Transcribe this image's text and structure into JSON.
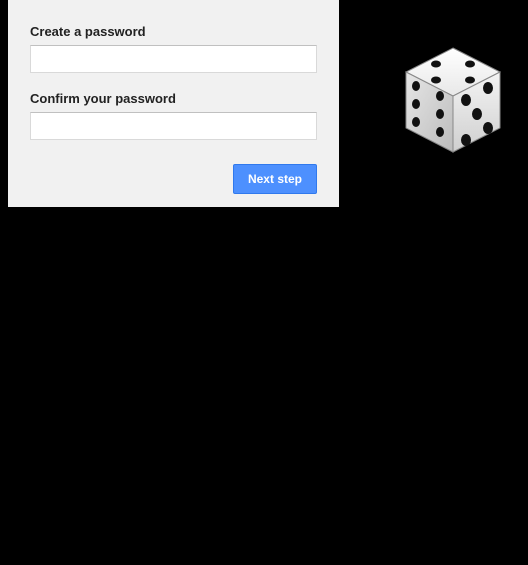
{
  "form": {
    "create_label": "Create a password",
    "create_value": "",
    "confirm_label": "Confirm your password",
    "confirm_value": "",
    "next_button": "Next step"
  },
  "illustration": {
    "name": "dice-icon",
    "face_value": 5
  }
}
